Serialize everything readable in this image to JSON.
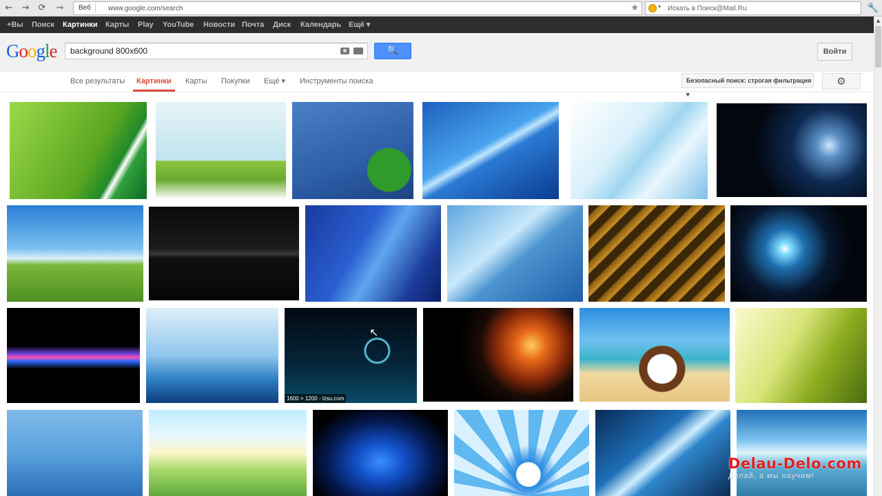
{
  "browser": {
    "nav": [
      "←",
      "→",
      "⟳",
      "⊸"
    ],
    "address_chip": "Веб",
    "address_url": "www.google.com/search",
    "star_glyph": "★",
    "mail_search_placeholder": "Искать в Поиск@Mail.Ru",
    "menu_glyph": "🔧"
  },
  "gbar": {
    "items": [
      "+Вы",
      "Поиск",
      "Картинки",
      "Карты",
      "Play",
      "YouTube",
      "Новости",
      "Почта",
      "Диск",
      "Календарь",
      "Ещё ▾"
    ],
    "active_index": 2
  },
  "header": {
    "logo": [
      "G",
      "o",
      "o",
      "g",
      "l",
      "e"
    ],
    "logo_colors": [
      "#1a5ed8",
      "#d8251f",
      "#f4b400",
      "#1a5ed8",
      "#1fa339",
      "#d8251f"
    ],
    "query": "background 800x600",
    "search_icon": "search-icon",
    "search_glyph": "🔍",
    "signin": "Войти"
  },
  "tabs": {
    "items": [
      "Все результаты",
      "Картинки",
      "Карты",
      "Покупки",
      "Ещё ▾",
      "Инструменты поиска"
    ],
    "active_index": 1,
    "safe_search": "Безопасный поиск: строгая фильтрация ▾",
    "gear_glyph": "⚙"
  },
  "results": {
    "caption": "1600 × 1200 - lzsu.com",
    "cursor_glyph": "🖱"
  },
  "watermark": {
    "title": "Delau-Delo.com",
    "subtitle": "Делай, а мы научим!"
  },
  "colors": {
    "accent_red": "#dd4b39",
    "search_blue": "#4d90fe",
    "gbar_bg": "#2d2d2d"
  }
}
